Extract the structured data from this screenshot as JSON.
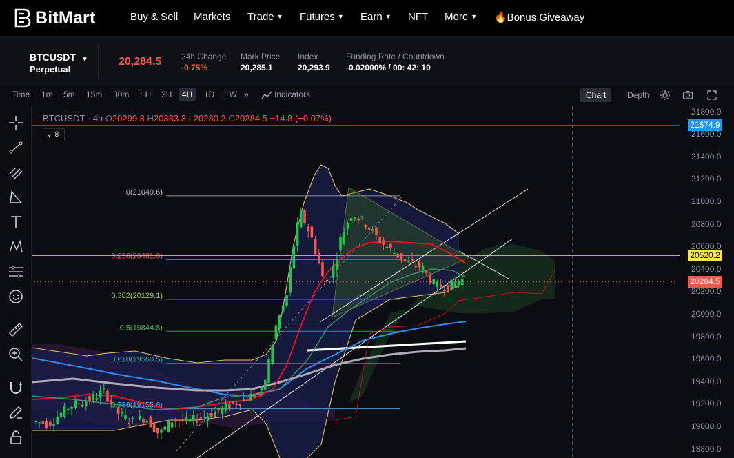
{
  "nav": {
    "brand": "BitMart",
    "items": [
      {
        "label": "Buy & Sell",
        "caret": false
      },
      {
        "label": "Markets",
        "caret": false
      },
      {
        "label": "Trade",
        "caret": true
      },
      {
        "label": "Futures",
        "caret": true
      },
      {
        "label": "Earn",
        "caret": true
      },
      {
        "label": "NFT",
        "caret": false
      },
      {
        "label": "More",
        "caret": true
      }
    ],
    "bonus": "🔥Bonus Giveaway"
  },
  "ticker": {
    "symbol": "BTCUSDT",
    "contract": "Perpetual",
    "last_price": "20,284.5",
    "change_label": "24h Change",
    "change_value": "-0.75%",
    "mark_label": "Mark Price",
    "mark_value": "20,285.1",
    "index_label": "Index",
    "index_value": "20,293.9",
    "funding_label": "Funding Rate / Countdown",
    "funding_value": "-0.02000% / 00: 42: 10"
  },
  "toolbar": {
    "timeframes": [
      "Time",
      "1m",
      "5m",
      "15m",
      "30m",
      "1H",
      "2H",
      "4H",
      "1D",
      "1W"
    ],
    "active_timeframe": "4H",
    "indicators_label": "Indicators",
    "chart_label": "Chart",
    "depth_label": "Depth"
  },
  "legend": {
    "symbol": "BTCUSDT · 4h",
    "open_key": "O",
    "open": "20299.3",
    "high_key": "H",
    "high": "20383.3",
    "low_key": "L",
    "low": "20280.2",
    "close_key": "C",
    "close": "20284.5",
    "change": "−14.8 (−0.07%)",
    "indicator_count": "8"
  },
  "axis": {
    "ticks": [
      "21800.0",
      "21600.0",
      "21400.0",
      "21200.0",
      "21000.0",
      "20800.0",
      "20600.0",
      "20400.0",
      "20200.0",
      "20000.0",
      "19800.0",
      "19600.0",
      "19400.0",
      "19200.0",
      "19000.0",
      "18800.0"
    ],
    "tags": [
      {
        "price": 21674.9,
        "label": "21674.9",
        "color": "#2196f3"
      },
      {
        "price": 20520.2,
        "label": "20520.2",
        "color": "#ffeb3b",
        "text": "#000"
      },
      {
        "price": 20284.5,
        "label": "20284.5",
        "color": "#f6574b"
      }
    ]
  },
  "fib": [
    {
      "label": "0(21049.6)",
      "price": 21049.6,
      "color": "#b0b4bf"
    },
    {
      "label": "0.236(20481.0)",
      "price": 20481.0,
      "color": "#f6574b"
    },
    {
      "label": "0.382(20129.1)",
      "price": 20129.1,
      "color": "#9ccc65"
    },
    {
      "label": "0.5(19844.8)",
      "price": 19844.8,
      "color": "#4caf50"
    },
    {
      "label": "0.618(19560.5)",
      "price": 19560.5,
      "color": "#26a69a"
    },
    {
      "label": "0.786(19155.6)",
      "price": 19155.6,
      "color": "#64b5f6"
    }
  ],
  "colors": {
    "up": "#26c24a",
    "down": "#f6574b",
    "bg": "#0b0d12"
  }
}
